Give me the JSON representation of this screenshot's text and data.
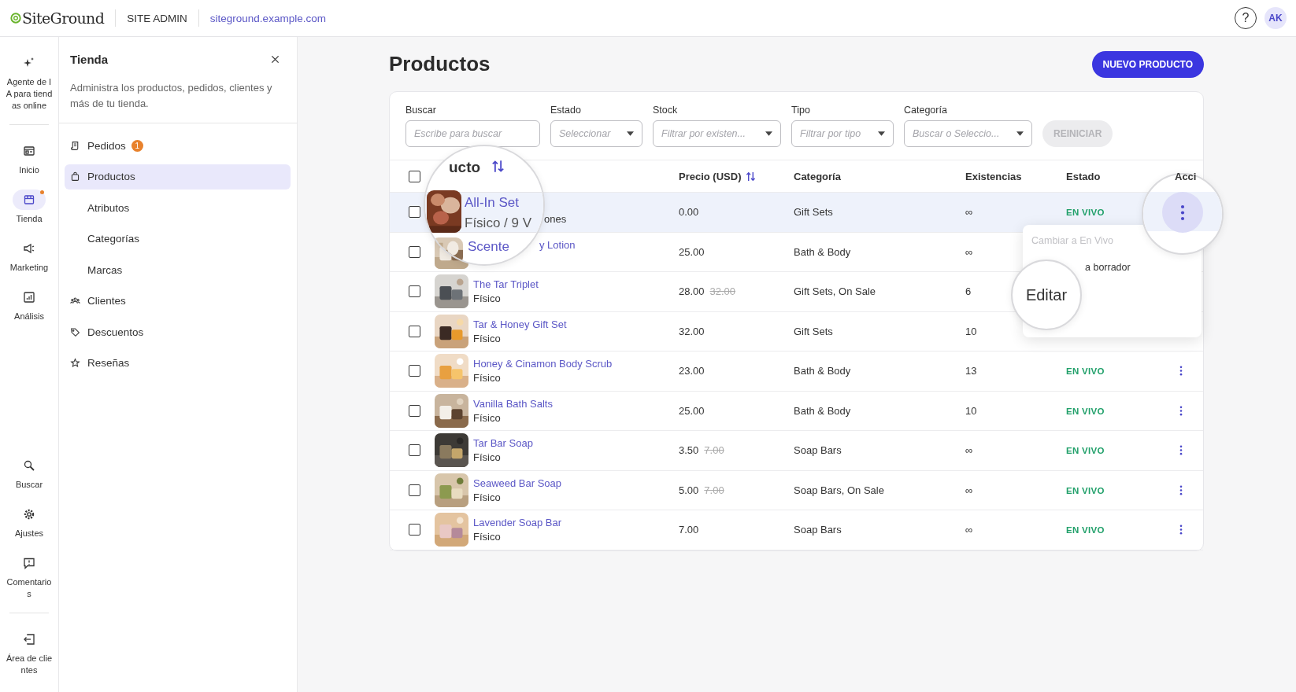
{
  "topbar": {
    "logo": "SiteGround",
    "section": "SITE ADMIN",
    "site_url": "siteground.example.com",
    "help": "?",
    "avatar": "AK"
  },
  "rail": {
    "top": [
      {
        "kind": "sparkle",
        "label": "Agente de IA para tiendas online",
        "selected": false,
        "notification": false
      }
    ],
    "main": [
      {
        "kind": "home",
        "label": "Inicio",
        "selected": false,
        "notification": false
      },
      {
        "kind": "store",
        "label": "Tienda",
        "selected": true,
        "notification": true
      },
      {
        "kind": "megaphone",
        "label": "Marketing",
        "selected": false,
        "notification": false
      },
      {
        "kind": "chart",
        "label": "Análisis",
        "selected": false,
        "notification": false
      }
    ],
    "bottom": [
      {
        "kind": "search",
        "label": "Buscar",
        "selected": false,
        "notification": false
      },
      {
        "kind": "gear",
        "label": "Ajustes",
        "selected": false,
        "notification": false
      },
      {
        "kind": "feedback",
        "label": "Comentarios",
        "selected": false,
        "notification": false
      }
    ],
    "footer": [
      {
        "kind": "exit",
        "label": "Área de clientes",
        "selected": false,
        "notification": false
      }
    ]
  },
  "panel": {
    "title": "Tienda",
    "description": "Administra los productos, pedidos, clientes y más de tu tienda.",
    "items": [
      {
        "kind": "receipt",
        "label": "Pedidos",
        "badge": "1",
        "selected": false
      },
      {
        "kind": "bag",
        "label": "Productos",
        "selected": true
      },
      {
        "kind": "plain",
        "label": "Atributos",
        "selected": false
      },
      {
        "kind": "plain",
        "label": "Categorías",
        "selected": false
      },
      {
        "kind": "plain",
        "label": "Marcas",
        "selected": false
      },
      {
        "kind": "people",
        "label": "Clientes",
        "selected": false
      },
      {
        "kind": "tag",
        "label": "Descuentos",
        "selected": false
      },
      {
        "kind": "star",
        "label": "Reseñas",
        "selected": false
      }
    ]
  },
  "page": {
    "title": "Productos",
    "new_button": "NUEVO PRODUCTO"
  },
  "filters": [
    {
      "kind": "text",
      "label": "Buscar",
      "placeholder": "Escribe para buscar"
    },
    {
      "kind": "select",
      "label": "Estado",
      "placeholder": "Seleccionar"
    },
    {
      "kind": "select",
      "label": "Stock",
      "placeholder": "Filtrar por existen..."
    },
    {
      "kind": "select",
      "label": "Tipo",
      "placeholder": "Filtrar por tipo"
    },
    {
      "kind": "select",
      "label": "Categoría",
      "placeholder": "Buscar o Seleccio..."
    }
  ],
  "reset_button": {
    "label": "REINICIAR",
    "disabled": true
  },
  "table": {
    "select_all": {
      "checked": false
    },
    "columns": [
      {
        "label": "Precio (USD)",
        "sortable": true
      },
      {
        "label": "Categoría",
        "sortable": false
      },
      {
        "label": "Existencias",
        "sortable": false
      },
      {
        "label": "Estado",
        "sortable": false
      },
      {
        "label": "Acci",
        "sortable": false
      }
    ],
    "rows": [
      {
        "selected": true,
        "checked": false,
        "subtitle_tail": "ones",
        "price": "0.00",
        "category": "Gift Sets",
        "stock": "∞",
        "status": "EN VIVO"
      },
      {
        "selected": false,
        "checked": false,
        "thumbnail": true,
        "name_tail": "y Lotion",
        "price": "25.00",
        "category": "Bath & Body",
        "stock": "∞"
      },
      {
        "selected": false,
        "checked": false,
        "thumbnail": true,
        "name": "The Tar Triplet",
        "subtitle": "Físico",
        "price": "28.00",
        "old_price": "32.00",
        "category": "Gift Sets, On Sale",
        "stock": "6"
      },
      {
        "selected": false,
        "checked": false,
        "thumbnail": true,
        "name": "Tar & Honey Gift Set",
        "subtitle": "Físico",
        "price": "32.00",
        "category": "Gift Sets",
        "stock": "10"
      },
      {
        "selected": false,
        "checked": false,
        "thumbnail": true,
        "name": "Honey & Cinamon Body Scrub",
        "subtitle": "Físico",
        "price": "23.00",
        "category": "Bath & Body",
        "stock": "13",
        "status": "EN VIVO",
        "menu_button": true
      },
      {
        "selected": false,
        "checked": false,
        "thumbnail": true,
        "name": "Vanilla Bath Salts",
        "subtitle": "Físico",
        "price": "25.00",
        "category": "Bath & Body",
        "stock": "10",
        "status": "EN VIVO",
        "menu_button": true
      },
      {
        "selected": false,
        "checked": false,
        "thumbnail": true,
        "name": "Tar Bar Soap",
        "subtitle": "Físico",
        "price": "3.50",
        "old_price": "7.00",
        "category": "Soap Bars",
        "stock": "∞",
        "status": "EN VIVO",
        "menu_button": true
      },
      {
        "selected": false,
        "checked": false,
        "thumbnail": true,
        "name": "Seaweed Bar Soap",
        "subtitle": "Físico",
        "price": "5.00",
        "old_price": "7.00",
        "category": "Soap Bars, On Sale",
        "stock": "∞",
        "status": "EN VIVO",
        "menu_button": true
      },
      {
        "selected": false,
        "checked": false,
        "thumbnail": true,
        "name": "Lavender Soap Bar",
        "subtitle": "Físico",
        "price": "7.00",
        "category": "Soap Bars",
        "stock": "∞",
        "status": "EN VIVO",
        "menu_button": true
      }
    ]
  },
  "actions_menu": {
    "items": [
      {
        "label": "Cambiar a En Vivo",
        "disabled": true
      },
      {
        "label": "a borrador",
        "disabled": false
      }
    ]
  },
  "magnifiers": {
    "product": {
      "header": "ucto",
      "name": "All-In Set",
      "subtitle": "Físico / 9 V",
      "next_name": "Scente"
    },
    "actions": {
      "highlighted": true
    },
    "edit": {
      "label": "Editar"
    }
  }
}
